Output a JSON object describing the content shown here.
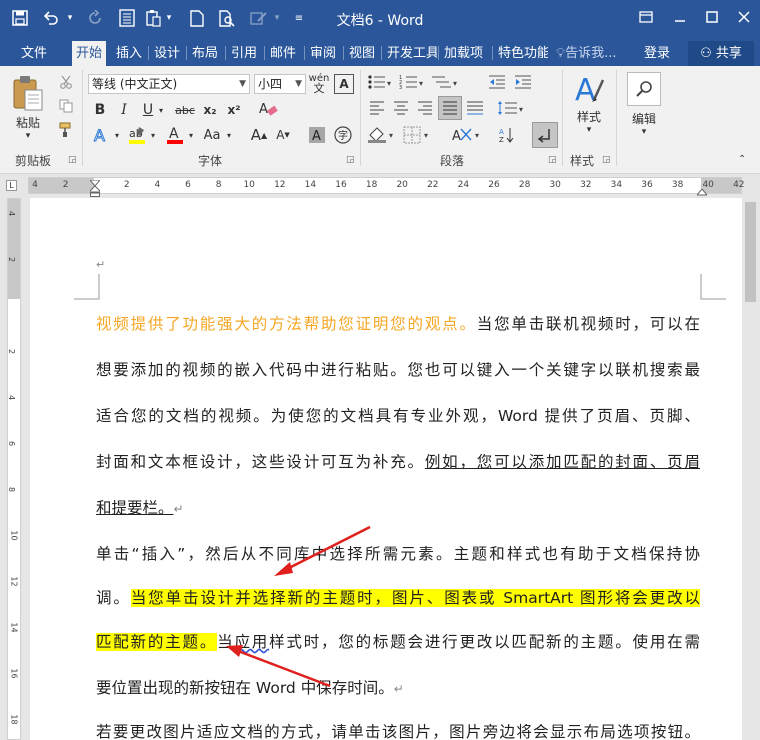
{
  "app": {
    "title": "文档6 - Word",
    "quick_access": {
      "save_icon": "save-icon",
      "undo_icon": "undo-icon",
      "redo_icon": "redo-icon"
    }
  },
  "tabs": [
    {
      "label": "文件",
      "active": false
    },
    {
      "label": "开始",
      "active": true
    },
    {
      "label": "插入",
      "active": false
    },
    {
      "label": "设计",
      "active": false
    },
    {
      "label": "布局",
      "active": false
    },
    {
      "label": "引用",
      "active": false
    },
    {
      "label": "邮件",
      "active": false
    },
    {
      "label": "审阅",
      "active": false
    },
    {
      "label": "视图",
      "active": false
    },
    {
      "label": "开发工具",
      "active": false
    },
    {
      "label": "加载项",
      "active": false
    },
    {
      "label": "特色功能",
      "active": false
    }
  ],
  "tell_me": "告诉我...",
  "login": "登录",
  "share": "共享",
  "ribbon": {
    "clipboard": {
      "paste_label": "粘贴",
      "group_label": "剪贴板"
    },
    "font": {
      "font_name": "等线 (中文正文)",
      "font_size": "小四",
      "phonetic": "wén",
      "bold": "B",
      "italic": "I",
      "underline": "U",
      "strike": "abc",
      "subscript": "x₂",
      "superscript": "x²",
      "change_case": "Aa",
      "grow": "A",
      "shrink": "A",
      "group_label": "字体"
    },
    "paragraph": {
      "group_label": "段落"
    },
    "styles": {
      "label": "样式",
      "group_label": "样式"
    },
    "editing": {
      "label": "编辑"
    }
  },
  "ruler": {
    "h_labels": [
      "4",
      "2",
      "",
      "2",
      "4",
      "6",
      "8",
      "10",
      "12",
      "14",
      "16",
      "18",
      "20",
      "22",
      "24",
      "26",
      "28",
      "30",
      "32",
      "34",
      "36",
      "38",
      "40",
      "42"
    ],
    "v_labels": [
      "4",
      "2",
      "",
      "2",
      "4",
      "6",
      "8",
      "10",
      "12",
      "14",
      "16",
      "18"
    ]
  },
  "document": {
    "lines": [
      {
        "segments": [
          {
            "text": "视频提供了功能强大的方法帮助您证明您的观点。",
            "style": "orange"
          },
          {
            "text": "当您单击联机视频时，可以在",
            "style": ""
          }
        ]
      },
      {
        "segments": [
          {
            "text": "想要添加的视频的嵌入代码中进行粘贴。您也可以键入一个关键字以联机搜索最",
            "style": ""
          }
        ]
      },
      {
        "segments": [
          {
            "text": "适合您的文档的视频。为使您的文档具有专业外观，Word 提供了页眉、页脚、",
            "style": ""
          }
        ]
      },
      {
        "segments": [
          {
            "text": "封面和文本框设计，这些设计可互为补充。",
            "style": ""
          },
          {
            "text": "例如，您可以添加匹配的封面、页眉",
            "style": "ul"
          }
        ]
      },
      {
        "segments": [
          {
            "text": "和提要栏。",
            "style": "ul"
          },
          {
            "text": "↵",
            "style": "pm"
          }
        ],
        "last": true
      },
      {
        "segments": [
          {
            "text": "单击“插入”，然后从不同库中选择所需元素。主题和样式也有助于文档保持协",
            "style": ""
          }
        ]
      },
      {
        "segments": [
          {
            "text": "调。",
            "style": ""
          },
          {
            "text": "当您单击设计并选择新的主题时，图片、图表或 SmartArt 图形将会更改以",
            "style": "hl"
          }
        ]
      },
      {
        "segments": [
          {
            "text": "匹配新的主题。",
            "style": "hl"
          },
          {
            "text": "当",
            "style": ""
          },
          {
            "text": "应用",
            "style": "squig"
          },
          {
            "text": "样式时，您的标题会进行更改以匹配新的主题。使用在需",
            "style": ""
          }
        ]
      },
      {
        "segments": [
          {
            "text": "要位置出现的新按钮在 Word 中保存时间。",
            "style": ""
          },
          {
            "text": "↵",
            "style": "pm"
          }
        ],
        "last": true
      },
      {
        "segments": [
          {
            "text": "若要更改图片适应文档的方式，请单击该图片，图片旁边将会显示布局选项按钮。",
            "style": ""
          }
        ]
      }
    ],
    "paragraph_mark": "↵"
  },
  "colors": {
    "brand": "#2b579a",
    "highlight": "#ffff00",
    "orange_text": "#f5a623",
    "arrow": "#e0201d"
  }
}
